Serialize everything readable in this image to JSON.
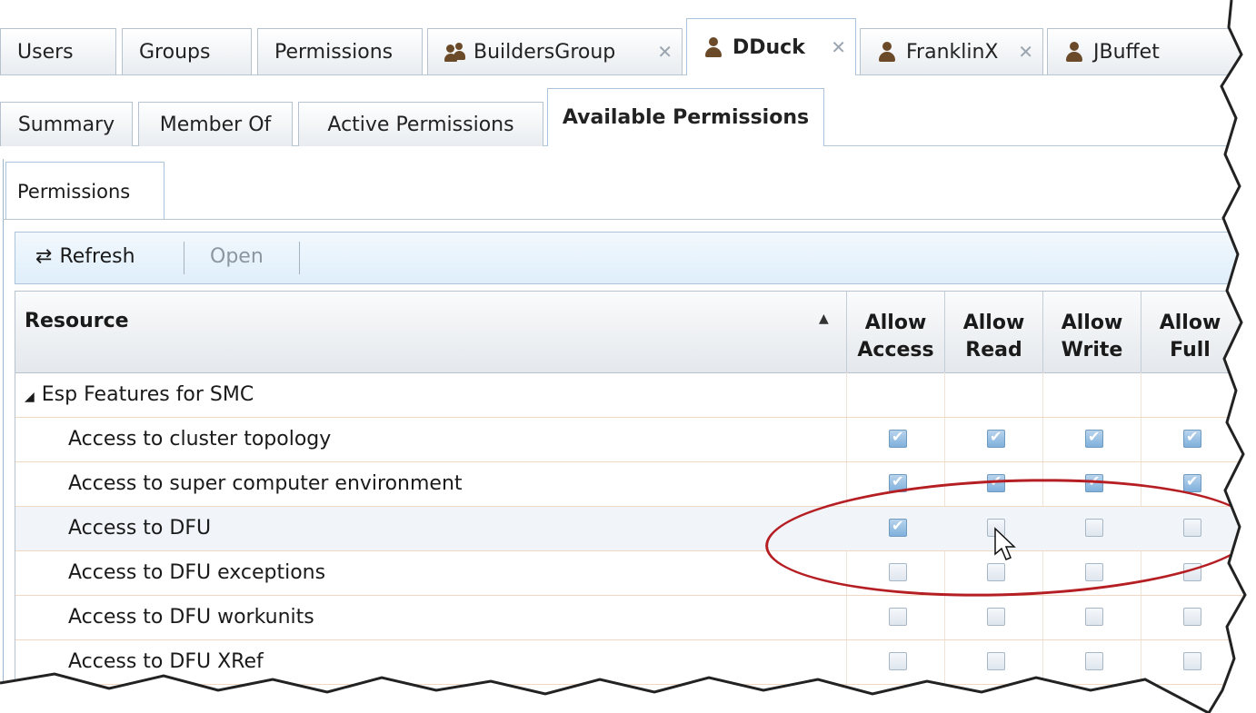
{
  "main_tabs": [
    {
      "label": "Users",
      "icon": "",
      "closable": false
    },
    {
      "label": "Groups",
      "icon": "",
      "closable": false
    },
    {
      "label": "Permissions",
      "icon": "",
      "closable": false
    },
    {
      "label": "BuildersGroup",
      "icon": "group-icon",
      "closable": true
    },
    {
      "label": "DDuck",
      "icon": "user-icon",
      "closable": true,
      "active": true
    },
    {
      "label": "FranklinX",
      "icon": "user-icon",
      "closable": true
    },
    {
      "label": "JBuffet",
      "icon": "user-icon",
      "closable": true
    }
  ],
  "sub_tabs": [
    "Summary",
    "Member Of",
    "Active Permissions",
    "Available Permissions"
  ],
  "active_sub_tab": "Available Permissions",
  "panel_tab": "Permissions",
  "toolbar": {
    "refresh": "Refresh",
    "open": "Open"
  },
  "grid": {
    "resource_header": "Resource",
    "columns": [
      {
        "line1": "Allow",
        "line2": "Access"
      },
      {
        "line1": "Allow",
        "line2": "Read"
      },
      {
        "line1": "Allow",
        "line2": "Write"
      },
      {
        "line1": "Allow",
        "line2": "Full"
      }
    ],
    "group": "Esp Features for SMC",
    "rows": [
      {
        "label": "Access to cluster topology",
        "checks": [
          true,
          true,
          true,
          true
        ]
      },
      {
        "label": "Access to super computer environment",
        "checks": [
          true,
          true,
          true,
          true
        ]
      },
      {
        "label": "Access to DFU",
        "checks": [
          true,
          false,
          false,
          false
        ]
      },
      {
        "label": "Access to DFU exceptions",
        "checks": [
          false,
          false,
          false,
          false
        ]
      },
      {
        "label": "Access to DFU workunits",
        "checks": [
          false,
          false,
          false,
          false
        ]
      },
      {
        "label": "Access to DFU XRef",
        "checks": [
          false,
          false,
          false,
          false
        ]
      }
    ]
  },
  "colors": {
    "annotation": "#b51f24",
    "accent": "#a9c4dc"
  }
}
